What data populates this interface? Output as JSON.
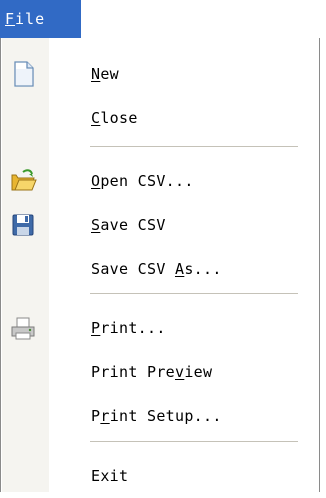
{
  "menubar": {
    "file": {
      "label": "File",
      "mnemonic": "F"
    }
  },
  "menu": {
    "items": [
      {
        "label": "New",
        "mnemonic_index": 0,
        "icon": "new-document-icon"
      },
      {
        "label": "Close",
        "mnemonic_index": 0,
        "icon": ""
      },
      {
        "label": "Open CSV...",
        "mnemonic_index": 0,
        "icon": "open-folder-icon"
      },
      {
        "label": "Save CSV",
        "mnemonic_index": 0,
        "icon": "save-disk-icon"
      },
      {
        "label": "Save CSV As...",
        "mnemonic_index": 9,
        "icon": ""
      },
      {
        "label": "Print...",
        "mnemonic_index": 0,
        "icon": "printer-icon"
      },
      {
        "label": "Print Preview",
        "mnemonic_index": 9,
        "icon": ""
      },
      {
        "label": "Print Setup...",
        "mnemonic_index": 1,
        "icon": ""
      },
      {
        "label": "Exit",
        "mnemonic_index": -1,
        "icon": ""
      }
    ]
  },
  "colors": {
    "menubar_highlight": "#316ac5",
    "gutter": "#f5f4f0",
    "separator": "#c5c2b8"
  }
}
